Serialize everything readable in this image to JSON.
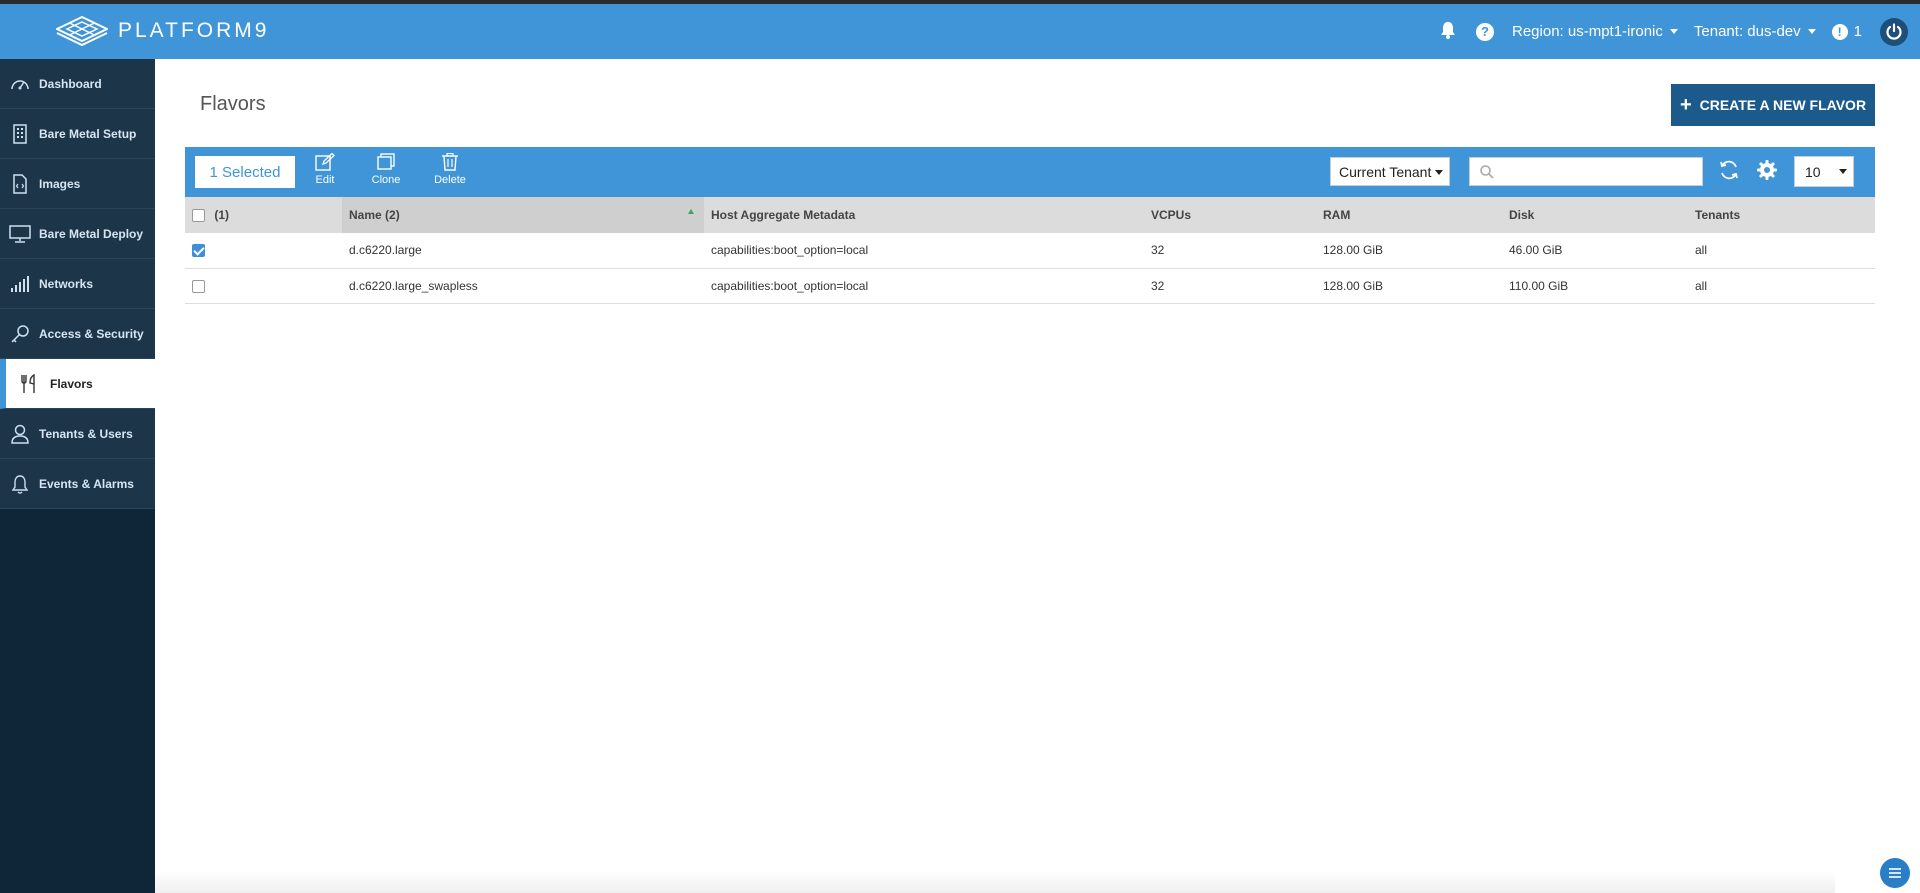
{
  "header": {
    "logo_text": "PLATFORM9",
    "region_label": "Region: us-mpt1-ironic",
    "tenant_label": "Tenant: dus-dev",
    "alert_count": "1",
    "colors": {
      "header_bg": "#3f95d7",
      "sidebar_bg": "#0f2638",
      "accent": "#1c5a8c"
    }
  },
  "sidebar": {
    "items": [
      {
        "label": "Dashboard",
        "icon": "dashboard-icon"
      },
      {
        "label": "Bare Metal Setup",
        "icon": "building-icon"
      },
      {
        "label": "Images",
        "icon": "file-code-icon"
      },
      {
        "label": "Bare Metal Deploy",
        "icon": "monitor-icon"
      },
      {
        "label": "Networks",
        "icon": "signal-bars-icon"
      },
      {
        "label": "Access & Security",
        "icon": "key-icon"
      },
      {
        "label": "Flavors",
        "icon": "utensils-icon",
        "active": true
      },
      {
        "label": "Tenants & Users",
        "icon": "user-icon"
      },
      {
        "label": "Events & Alarms",
        "icon": "bell-icon"
      }
    ]
  },
  "page": {
    "title": "Flavors",
    "create_button": "CREATE A NEW FLAVOR"
  },
  "toolbar": {
    "selected_label": "1 Selected",
    "edit_label": "Edit",
    "clone_label": "Clone",
    "delete_label": "Delete",
    "tenant_filter": "Current Tenant",
    "search_placeholder": "",
    "page_size": "10"
  },
  "table": {
    "headers": {
      "select_count": "(1)",
      "name": "Name (2)",
      "metadata": "Host Aggregate Metadata",
      "vcpus": "VCPUs",
      "ram": "RAM",
      "disk": "Disk",
      "tenants": "Tenants"
    },
    "rows": [
      {
        "checked": true,
        "name": "d.c6220.large",
        "metadata": "capabilities:boot_option=local",
        "vcpus": "32",
        "ram": "128.00 GiB",
        "disk": "46.00 GiB",
        "tenants": "all"
      },
      {
        "checked": false,
        "name": "d.c6220.large_swapless",
        "metadata": "capabilities:boot_option=local",
        "vcpus": "32",
        "ram": "128.00 GiB",
        "disk": "110.00 GiB",
        "tenants": "all"
      }
    ]
  }
}
